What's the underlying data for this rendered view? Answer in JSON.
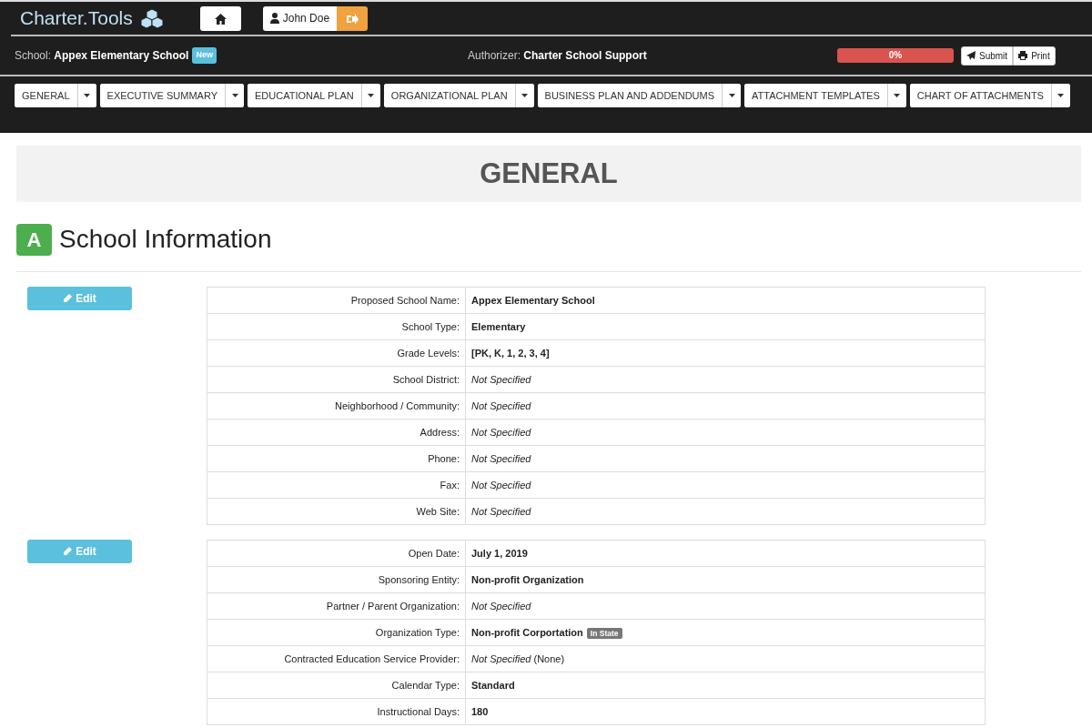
{
  "brand": {
    "title": "Charter.Tools"
  },
  "user": {
    "name": "John Doe"
  },
  "school": {
    "label": "School:",
    "value": "Appex Elementary School",
    "badge": "New"
  },
  "authorizer": {
    "label": "Authorizer:",
    "value": "Charter School Support"
  },
  "progress": {
    "level": 0,
    "reading": "0%"
  },
  "actions": [
    {
      "kind": "submit",
      "label": "Submit"
    },
    {
      "kind": "print",
      "label": "Print"
    }
  ],
  "tabs": [
    {
      "label": "GENERAL"
    },
    {
      "label": "EXECUTIVE SUMMARY"
    },
    {
      "label": "EDUCATIONAL PLAN"
    },
    {
      "label": "ORGANIZATIONAL PLAN"
    },
    {
      "label": "BUSINESS PLAN AND ADDENDUMS"
    },
    {
      "label": "ATTACHMENT TEMPLATES"
    },
    {
      "label": "CHART OF ATTACHMENTS"
    }
  ],
  "page_title": "GENERAL",
  "section": {
    "letter": "A",
    "title": "School Information"
  },
  "groups": [
    {
      "edit_label": "Edit",
      "rows": [
        {
          "label": "Proposed School Name:",
          "value": "Appex Elementary School",
          "kind": "set"
        },
        {
          "label": "School Type:",
          "value": "Elementary",
          "kind": "set"
        },
        {
          "label": "Grade Levels:",
          "value": "[PK, K, 1, 2, 3, 4]",
          "kind": "set"
        },
        {
          "label": "School District:",
          "value": "Not Specified",
          "kind": "unset"
        },
        {
          "label": "Neighborhood / Community:",
          "value": "Not Specified",
          "kind": "unset"
        },
        {
          "label": "Address:",
          "value": "Not Specified",
          "kind": "unset"
        },
        {
          "label": "Phone:",
          "value": "Not Specified",
          "kind": "unset"
        },
        {
          "label": "Fax:",
          "value": "Not Specified",
          "kind": "unset"
        },
        {
          "label": "Web Site:",
          "value": "Not Specified",
          "kind": "unset"
        }
      ]
    },
    {
      "edit_label": "Edit",
      "rows": [
        {
          "label": "Open Date:",
          "value": "July 1, 2019",
          "kind": "set"
        },
        {
          "label": "Sponsoring Entity:",
          "value": "Non-profit Organization",
          "kind": "set"
        },
        {
          "label": "Partner / Parent Organization:",
          "value": "Not Specified",
          "kind": "unset"
        },
        {
          "label": "Organization Type:",
          "value": "Non-profit Corportation",
          "kind": "set",
          "badge": "In State"
        },
        {
          "label": "Contracted Education Service Provider:",
          "value": "*Not Specified* (None)",
          "kind": "mixed"
        },
        {
          "label": "Calendar Type:",
          "value": "Standard",
          "kind": "set"
        },
        {
          "label": "Instructional Days:",
          "value": "180",
          "kind": "set"
        }
      ]
    }
  ]
}
